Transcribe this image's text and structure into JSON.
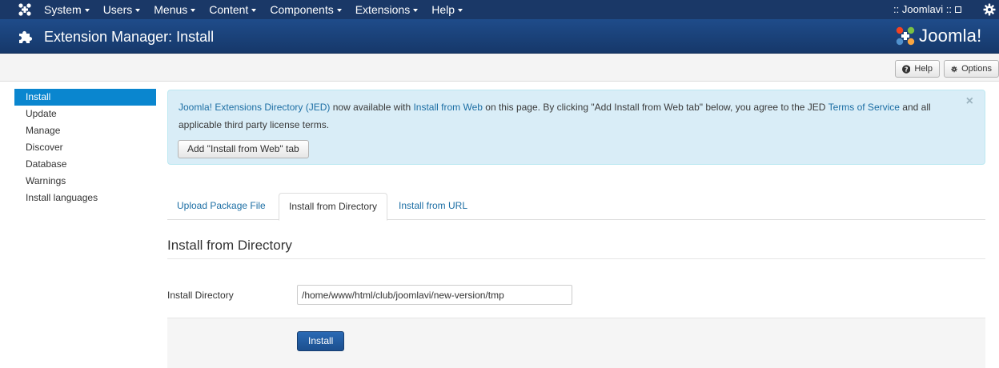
{
  "topnav": {
    "menu": [
      "System",
      "Users",
      "Menus",
      "Content",
      "Components",
      "Extensions",
      "Help"
    ],
    "site_link": ":: Joomlavi ::"
  },
  "header": {
    "title": "Extension Manager: Install",
    "brand": "Joomla!"
  },
  "toolbar": {
    "help_label": "Help",
    "options_label": "Options"
  },
  "sidebar": {
    "items": [
      "Install",
      "Update",
      "Manage",
      "Discover",
      "Database",
      "Warnings",
      "Install languages"
    ]
  },
  "alert": {
    "jed_link": "Joomla! Extensions Directory (JED)",
    "text_1": " now available with ",
    "install_web_link": "Install from Web",
    "text_2": " on this page.  By clicking \"Add Install from Web tab\" below, you agree to the JED ",
    "terms_link": "Terms of Service",
    "text_3": " and all applicable third party license terms.",
    "close_symbol": "×",
    "button_label": "Add \"Install from Web\" tab"
  },
  "tabs": [
    "Upload Package File",
    "Install from Directory",
    "Install from URL"
  ],
  "form": {
    "section_title": "Install from Directory",
    "directory_label": "Install Directory",
    "directory_value": "/home/www/html/club/joomlavi/new-version/tmp",
    "install_button": "Install"
  },
  "colors": {
    "nav_bg": "#1a3867",
    "title_bg": "#1f4c8a",
    "active_sidebar": "#0a86cf",
    "alert_bg": "#d9edf7",
    "link": "#1c6ea4",
    "primary_button": "#2a6ab5"
  },
  "icons": {
    "top_logo": "joomla-logo-icon",
    "external": "external-link-icon",
    "settings": "gear-icon",
    "header": "puzzle-icon",
    "help": "question-icon",
    "options": "gear-icon"
  }
}
